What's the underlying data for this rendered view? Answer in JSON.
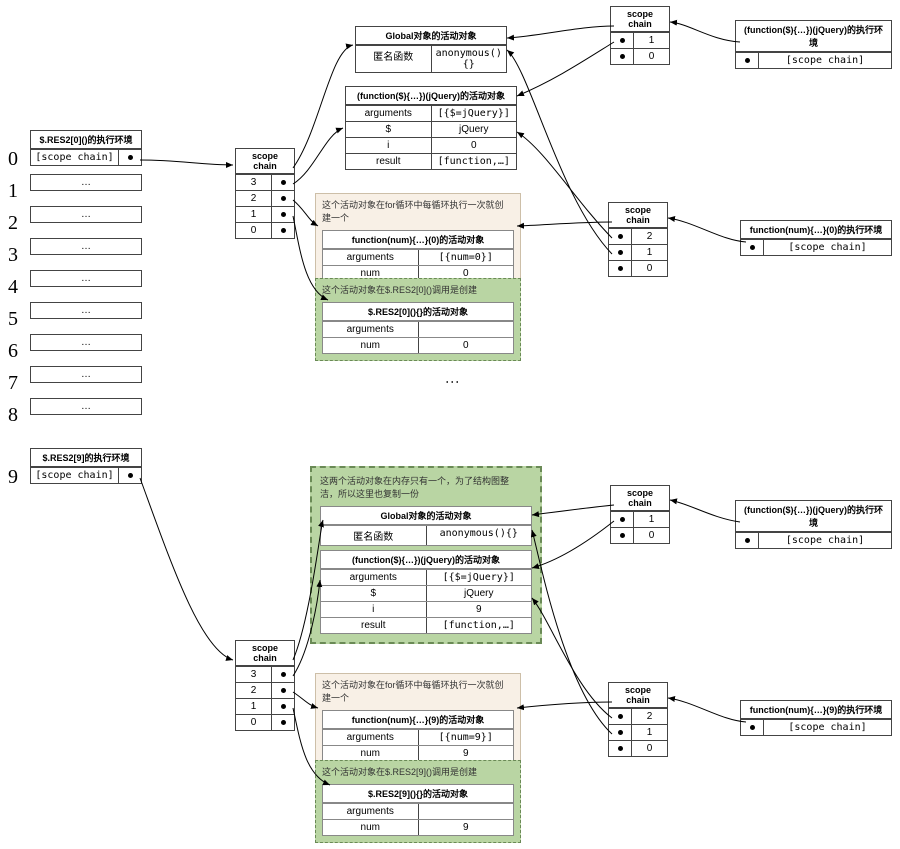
{
  "leftIdx": [
    "0",
    "1",
    "2",
    "3",
    "4",
    "5",
    "6",
    "7",
    "8",
    "9"
  ],
  "res0": {
    "title": "$.RES2[0]()的执行环境",
    "scope": "[scope chain]"
  },
  "res9": {
    "title": "$.RES2[9]的执行环境",
    "scope": "[scope chain]"
  },
  "cell_ellipsis": "…",
  "scA": {
    "title": "scope chain",
    "rows": [
      "3",
      "2",
      "1",
      "0"
    ]
  },
  "scB": {
    "title": "scope chain",
    "rows": [
      "3",
      "2",
      "1",
      "0"
    ]
  },
  "scTop": {
    "title": "scope chain",
    "rows": [
      "1",
      "0"
    ]
  },
  "scMidR": {
    "title": "scope chain",
    "rows": [
      "2",
      "1",
      "0"
    ]
  },
  "scBot1": {
    "title": "scope chain",
    "rows": [
      "1",
      "0"
    ]
  },
  "scBot2": {
    "title": "scope chain",
    "rows": [
      "2",
      "1",
      "0"
    ]
  },
  "globA": {
    "title": "Global对象的活动对象",
    "k": "匿名函数",
    "v": "anonymous(){}"
  },
  "jqA": {
    "title": "(function($){…})(jQuery)的活动对象",
    "rows": [
      [
        "arguments",
        "[{$=jQuery}]"
      ],
      [
        "$",
        "jQuery"
      ],
      [
        "i",
        "0"
      ],
      [
        "result",
        "[function,…]"
      ]
    ]
  },
  "fnNumA_note": "这个活动对象在for循环中每循环执行一次就创建一个",
  "fnNumA": {
    "title": "function(num){…}(0)的活动对象",
    "rows": [
      [
        "arguments",
        "[{num=0}]"
      ],
      [
        "num",
        "0"
      ]
    ]
  },
  "resCallA_note": "这个活动对象在$.RES2[0]()调用是创建",
  "resCallA": {
    "title": "$.RES2[0](){}的活动对象",
    "rows": [
      [
        "arguments",
        ""
      ],
      [
        "num",
        "0"
      ]
    ]
  },
  "rightTopEnv": {
    "title": "(function($){…})(jQuery)的执行环境",
    "scope": "[scope chain]"
  },
  "rightMidEnv": {
    "title": "function(num){…}(0)的执行环境",
    "scope": "[scope chain]"
  },
  "dup_note": "这两个活动对象在内存只有一个，为了结构图整洁，所以这里也复制一份",
  "globB": {
    "title": "Global对象的活动对象",
    "k": "匿名函数",
    "v": "anonymous(){}"
  },
  "jqB": {
    "title": "(function($){…})(jQuery)的活动对象",
    "rows": [
      [
        "arguments",
        "[{$=jQuery}]"
      ],
      [
        "$",
        "jQuery"
      ],
      [
        "i",
        "9"
      ],
      [
        "result",
        "[function,…]"
      ]
    ]
  },
  "fnNumB_note": "这个活动对象在for循环中每循环执行一次就创建一个",
  "fnNumB": {
    "title": "function(num){…}(9)的活动对象",
    "rows": [
      [
        "arguments",
        "[{num=9}]"
      ],
      [
        "num",
        "9"
      ]
    ]
  },
  "resCallB_note": "这个活动对象在$.RES2[9]()调用是创建",
  "resCallB": {
    "title": "$.RES2[9](){}的活动对象",
    "rows": [
      [
        "arguments",
        ""
      ],
      [
        "num",
        "9"
      ]
    ]
  },
  "rightBotEnv1": {
    "title": "(function($){…})(jQuery)的执行环境",
    "scope": "[scope chain]"
  },
  "rightBotEnv2": {
    "title": "function(num){…}(9)的执行环境",
    "scope": "[scope chain]"
  },
  "vdots": "⋮"
}
